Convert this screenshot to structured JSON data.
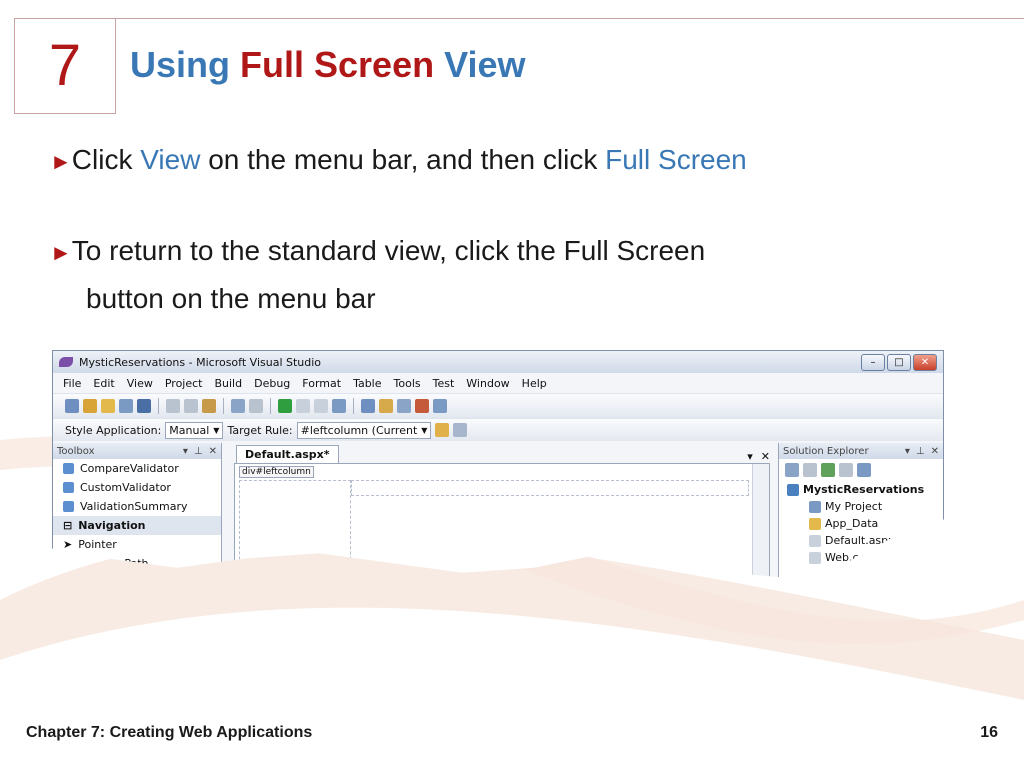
{
  "slide": {
    "chapter_number": "7",
    "title": {
      "pre": "Using ",
      "emphasis": "Full Screen",
      "post": " View"
    },
    "bullets": [
      {
        "parts": [
          "Click ",
          "View",
          " on the menu bar, and then click ",
          "Full Screen"
        ]
      },
      {
        "lines": [
          "To return to the standard view, click the Full Screen",
          "button on the menu bar"
        ]
      }
    ],
    "footer": {
      "left": "Chapter 7: Creating Web Applications",
      "right": "16"
    }
  },
  "screenshot": {
    "window_title": "MysticReservations - Microsoft Visual Studio",
    "menu": [
      "File",
      "Edit",
      "View",
      "Project",
      "Build",
      "Debug",
      "Format",
      "Table",
      "Tools",
      "Test",
      "Window",
      "Help"
    ],
    "style_bar": {
      "style_label": "Style Application:",
      "style_value": "Manual",
      "rule_label": "Target Rule:",
      "rule_value": "#leftcolumn (Current"
    },
    "toolbox": {
      "title": "Toolbox",
      "items": [
        {
          "label": "CompareValidator",
          "group": false
        },
        {
          "label": "CustomValidator",
          "group": false
        },
        {
          "label": "ValidationSummary",
          "group": false
        },
        {
          "label": "Navigation",
          "group": true
        },
        {
          "label": "Pointer",
          "group": false
        },
        {
          "label": "SiteMapPath",
          "group": false
        }
      ]
    },
    "editor": {
      "tab": "Default.aspx*",
      "tag": "div#leftcolumn"
    },
    "solution_explorer": {
      "title": "Solution Explorer",
      "root": "MysticReservations",
      "items": [
        "My Project",
        "App_Data",
        "Default.aspx",
        "Web.config"
      ]
    }
  }
}
